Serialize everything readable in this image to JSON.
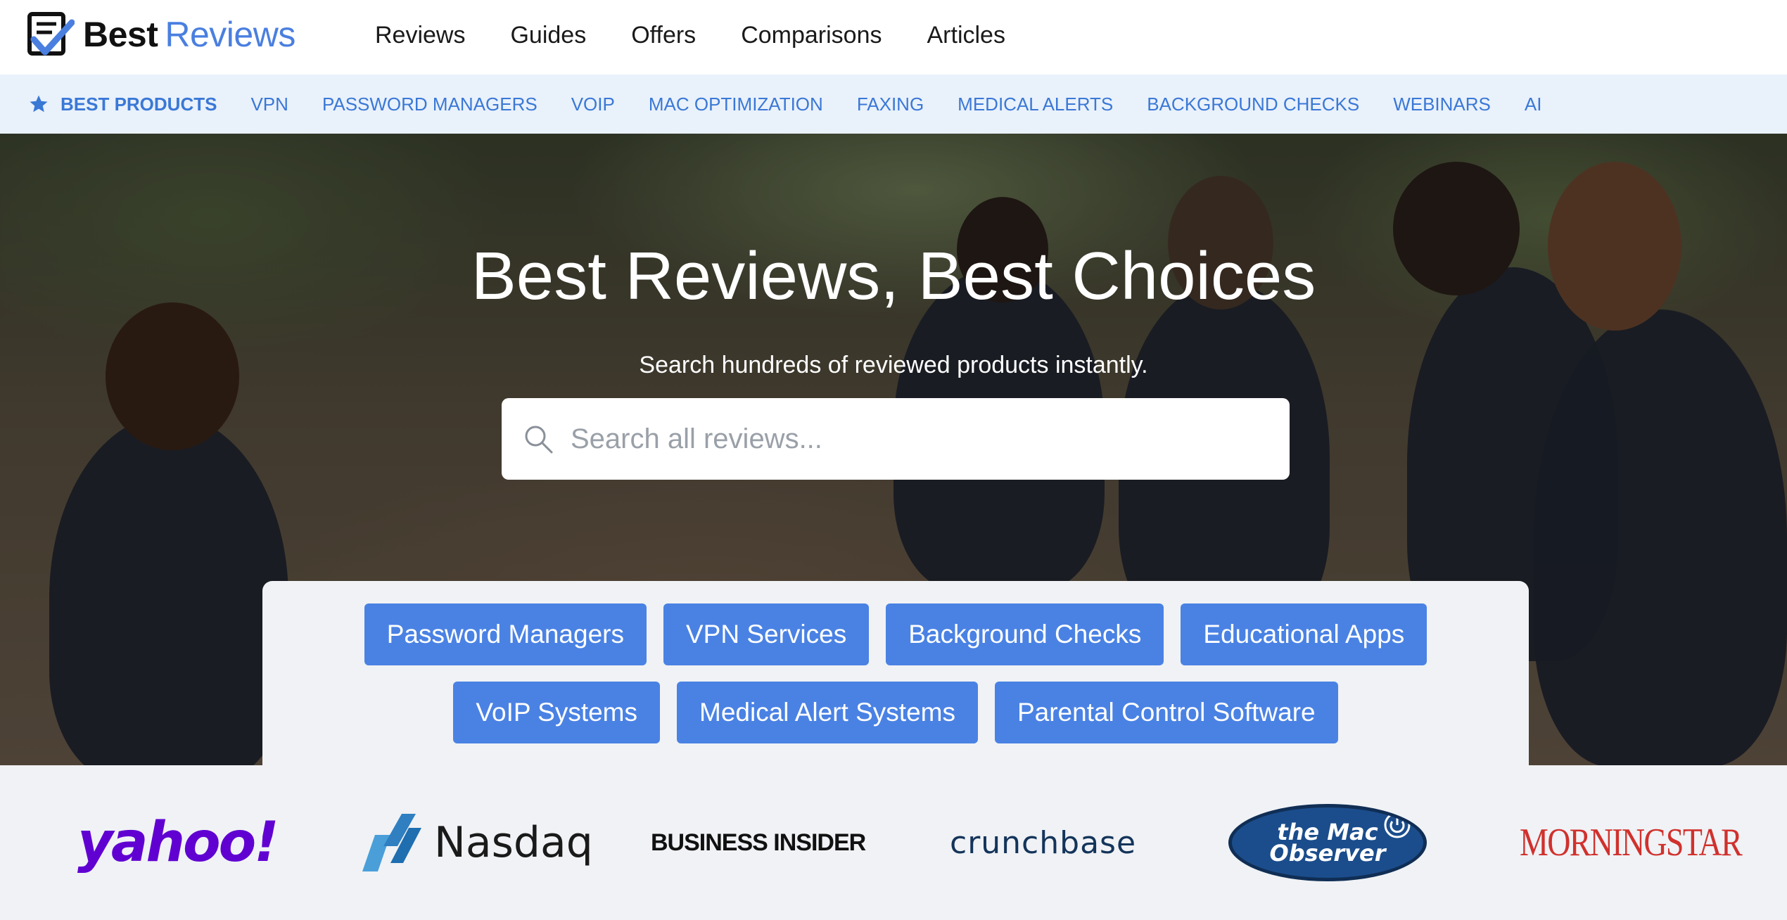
{
  "header": {
    "logo_word1": "Best",
    "logo_word2": "Reviews",
    "nav": [
      "Reviews",
      "Guides",
      "Offers",
      "Comparisons",
      "Articles"
    ]
  },
  "category_bar": {
    "items": [
      "BEST PRODUCTS",
      "VPN",
      "PASSWORD MANAGERS",
      "VOIP",
      "MAC OPTIMIZATION",
      "FAXING",
      "MEDICAL ALERTS",
      "BACKGROUND CHECKS",
      "WEBINARS",
      "AI"
    ],
    "icon": "star-icon",
    "accent": "#3a78d6"
  },
  "hero": {
    "title": "Best Reviews, Best Choices",
    "subtitle": "Search hundreds of reviewed products instantly.",
    "search_placeholder": "Search all reviews..."
  },
  "category_buttons": {
    "row1": [
      "Password Managers",
      "VPN Services",
      "Background Checks",
      "Educational Apps"
    ],
    "row2": [
      "VoIP Systems",
      "Medical Alert Systems",
      "Parental Control Software"
    ],
    "color": "#4a82e4"
  },
  "press_logos": [
    "yahoo!",
    "Nasdaq",
    "BUSINESS INSIDER",
    "crunchbase",
    "the Mac Observer",
    "MORNINGSTAR"
  ]
}
